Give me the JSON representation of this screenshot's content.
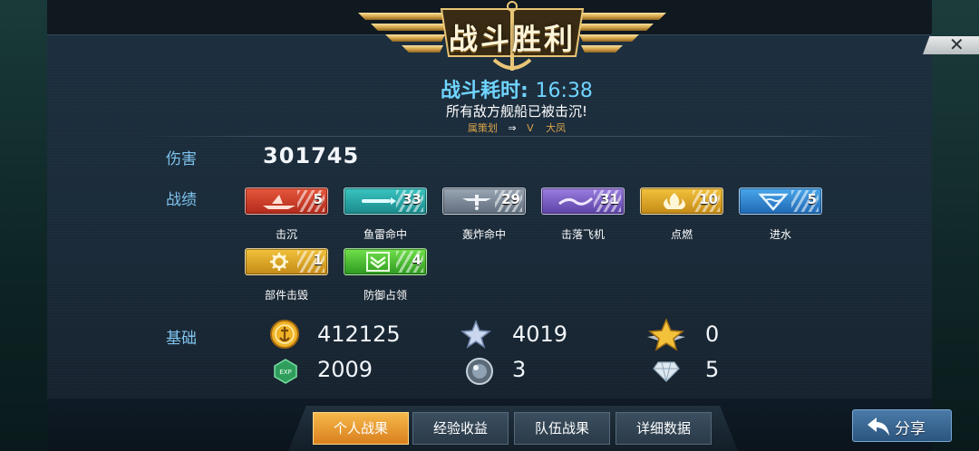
{
  "title": "战斗胜利",
  "battle_time_label": "战斗耗时:",
  "battle_time_value": "16:38",
  "result_message": "所有敌方舰船已被击沉!",
  "sub_info": {
    "left": "属策划",
    "mid": "V",
    "right": "大凤"
  },
  "rows": {
    "damage_label": "伤害",
    "damage_value": "301745",
    "record_label": "战绩",
    "base_label": "基础"
  },
  "medals": [
    {
      "label": "击沉",
      "count": "5",
      "color": "#c8372a",
      "icon": "ship-sunk-icon"
    },
    {
      "label": "鱼雷命中",
      "count": "33",
      "color": "#27a6a6",
      "icon": "torpedo-icon"
    },
    {
      "label": "轰炸命中",
      "count": "29",
      "color": "#7c8998",
      "icon": "bomb-plane-icon"
    },
    {
      "label": "击落飞机",
      "count": "31",
      "color": "#7a5fc6",
      "icon": "plane-shot-icon"
    },
    {
      "label": "点燃",
      "count": "10",
      "color": "#e0a82a",
      "icon": "fire-icon"
    },
    {
      "label": "进水",
      "count": "5",
      "color": "#3388d2",
      "icon": "water-icon"
    },
    {
      "label": "部件击毁",
      "count": "1",
      "color": "#e0a82a",
      "icon": "gear-icon"
    },
    {
      "label": "防御占领",
      "count": "4",
      "color": "#48bc34",
      "icon": "chevron-defense-icon"
    }
  ],
  "resources": [
    {
      "icon": "gold-coin-icon",
      "value": "412125"
    },
    {
      "icon": "silver-star-icon",
      "value": "4019"
    },
    {
      "icon": "gold-star-icon",
      "value": "0"
    },
    {
      "icon": "exp-icon",
      "value": "2009"
    },
    {
      "icon": "orb-icon",
      "value": "3"
    },
    {
      "icon": "diamond-icon",
      "value": "5"
    }
  ],
  "tabs": [
    {
      "label": "个人战果",
      "active": true
    },
    {
      "label": "经验收益",
      "active": false
    },
    {
      "label": "队伍战果",
      "active": false
    },
    {
      "label": "详细数据",
      "active": false
    }
  ],
  "share_label": "分享",
  "close_symbol": "✕"
}
